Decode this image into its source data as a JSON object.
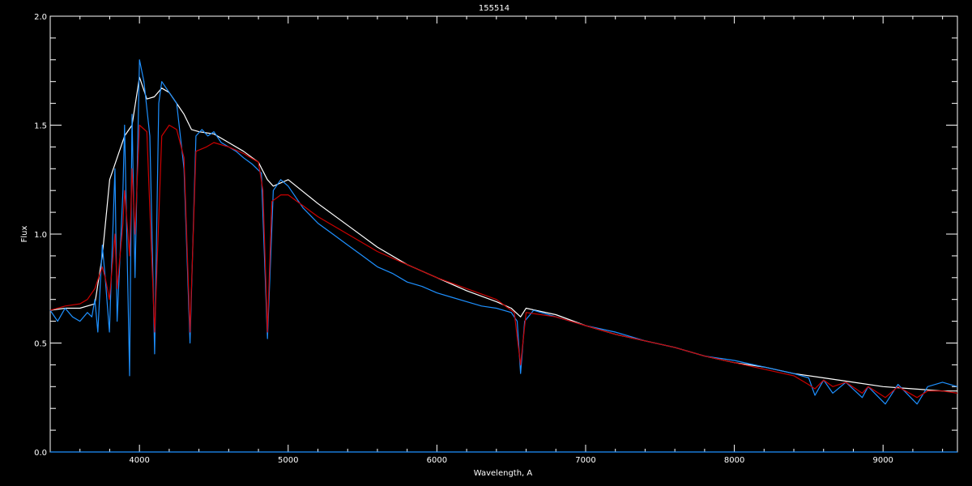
{
  "chart_data": {
    "type": "line",
    "title": "155514",
    "xlabel": "Wavelength, A",
    "ylabel": "Flux",
    "xlim": [
      3400,
      9500
    ],
    "ylim": [
      0.0,
      2.0
    ],
    "x_ticks": [
      4000,
      5000,
      6000,
      7000,
      8000,
      9000
    ],
    "x_tick_labels": [
      "4000",
      "5000",
      "6000",
      "7000",
      "8000",
      "9000"
    ],
    "y_ticks": [
      0.0,
      0.5,
      1.0,
      1.5,
      2.0
    ],
    "y_tick_labels": [
      "0.0",
      "0.5",
      "1.0",
      "1.5",
      "2.0"
    ],
    "grid": false,
    "legend": "none",
    "series": [
      {
        "color": "#ffffff",
        "x": [
          3400,
          3500,
          3600,
          3700,
          3750,
          3800,
          3850,
          3900,
          3950,
          4000,
          4050,
          4100,
          4150,
          4200,
          4250,
          4300,
          4350,
          4400,
          4500,
          4600,
          4700,
          4800,
          4860,
          4900,
          5000,
          5200,
          5400,
          5600,
          5800,
          6000,
          6200,
          6400,
          6500,
          6563,
          6600,
          6800,
          7000,
          7200,
          7400,
          7600,
          7800,
          8000,
          8200,
          8400,
          8600,
          8800,
          9000,
          9200,
          9400,
          9500
        ],
        "y": [
          0.65,
          0.66,
          0.66,
          0.68,
          0.9,
          1.25,
          1.35,
          1.45,
          1.5,
          1.72,
          1.62,
          1.63,
          1.67,
          1.65,
          1.6,
          1.55,
          1.48,
          1.47,
          1.46,
          1.42,
          1.38,
          1.33,
          1.25,
          1.22,
          1.25,
          1.14,
          1.04,
          0.94,
          0.86,
          0.8,
          0.74,
          0.69,
          0.66,
          0.62,
          0.66,
          0.63,
          0.58,
          0.54,
          0.51,
          0.48,
          0.44,
          0.41,
          0.39,
          0.36,
          0.34,
          0.32,
          0.3,
          0.29,
          0.28,
          0.28
        ]
      },
      {
        "color": "#1e90ff",
        "x": [
          3400,
          3450,
          3500,
          3550,
          3600,
          3650,
          3680,
          3700,
          3720,
          3750,
          3770,
          3798,
          3835,
          3850,
          3889,
          3900,
          3934,
          3950,
          3970,
          4000,
          4030,
          4070,
          4102,
          4130,
          4150,
          4200,
          4250,
          4300,
          4340,
          4380,
          4420,
          4460,
          4500,
          4550,
          4600,
          4650,
          4700,
          4760,
          4820,
          4861,
          4900,
          4950,
          5000,
          5100,
          5200,
          5300,
          5400,
          5500,
          5600,
          5700,
          5800,
          5900,
          6000,
          6100,
          6200,
          6300,
          6400,
          6500,
          6540,
          6563,
          6590,
          6650,
          6800,
          7000,
          7200,
          7400,
          7600,
          7800,
          8000,
          8200,
          8400,
          8500,
          8542,
          8600,
          8662,
          8750,
          8860,
          8900,
          9015,
          9100,
          9229,
          9300,
          9400,
          9500
        ],
        "y": [
          0.65,
          0.6,
          0.66,
          0.62,
          0.6,
          0.64,
          0.62,
          0.7,
          0.55,
          0.95,
          0.8,
          0.55,
          1.3,
          0.6,
          1.2,
          1.5,
          0.35,
          1.55,
          0.8,
          1.8,
          1.7,
          1.45,
          0.45,
          1.6,
          1.7,
          1.65,
          1.6,
          1.3,
          0.5,
          1.45,
          1.48,
          1.45,
          1.47,
          1.42,
          1.4,
          1.38,
          1.35,
          1.32,
          1.28,
          0.52,
          1.2,
          1.25,
          1.22,
          1.12,
          1.05,
          1.0,
          0.95,
          0.9,
          0.85,
          0.82,
          0.78,
          0.76,
          0.73,
          0.71,
          0.69,
          0.67,
          0.66,
          0.64,
          0.6,
          0.36,
          0.6,
          0.65,
          0.62,
          0.58,
          0.55,
          0.51,
          0.48,
          0.44,
          0.42,
          0.39,
          0.36,
          0.34,
          0.26,
          0.33,
          0.27,
          0.32,
          0.25,
          0.3,
          0.22,
          0.31,
          0.22,
          0.3,
          0.32,
          0.3
        ]
      },
      {
        "color": "#cc0000",
        "x": [
          3400,
          3500,
          3600,
          3650,
          3700,
          3750,
          3770,
          3798,
          3835,
          3850,
          3889,
          3900,
          3934,
          3950,
          3970,
          4000,
          4050,
          4102,
          4150,
          4200,
          4250,
          4300,
          4340,
          4380,
          4450,
          4500,
          4600,
          4700,
          4800,
          4830,
          4861,
          4890,
          4950,
          5000,
          5200,
          5400,
          5600,
          5800,
          6000,
          6200,
          6400,
          6520,
          6563,
          6600,
          6800,
          7000,
          7200,
          7400,
          7600,
          7800,
          8000,
          8200,
          8400,
          8498,
          8542,
          8600,
          8662,
          8750,
          8860,
          8900,
          9015,
          9100,
          9229,
          9300,
          9400,
          9500
        ],
        "y": [
          0.65,
          0.67,
          0.68,
          0.7,
          0.75,
          0.85,
          0.8,
          0.7,
          1.0,
          0.75,
          1.05,
          1.2,
          0.9,
          1.3,
          1.0,
          1.5,
          1.47,
          0.55,
          1.45,
          1.5,
          1.48,
          1.35,
          0.55,
          1.38,
          1.4,
          1.42,
          1.4,
          1.37,
          1.33,
          1.2,
          0.55,
          1.15,
          1.18,
          1.18,
          1.08,
          1.0,
          0.92,
          0.86,
          0.8,
          0.75,
          0.7,
          0.64,
          0.4,
          0.64,
          0.62,
          0.58,
          0.54,
          0.51,
          0.48,
          0.44,
          0.41,
          0.38,
          0.35,
          0.31,
          0.29,
          0.33,
          0.3,
          0.32,
          0.27,
          0.3,
          0.25,
          0.3,
          0.25,
          0.28,
          0.28,
          0.27
        ]
      },
      {
        "color": "#1e90ff",
        "x": [
          3400,
          9500
        ],
        "y": [
          0.0,
          0.0
        ]
      }
    ]
  }
}
